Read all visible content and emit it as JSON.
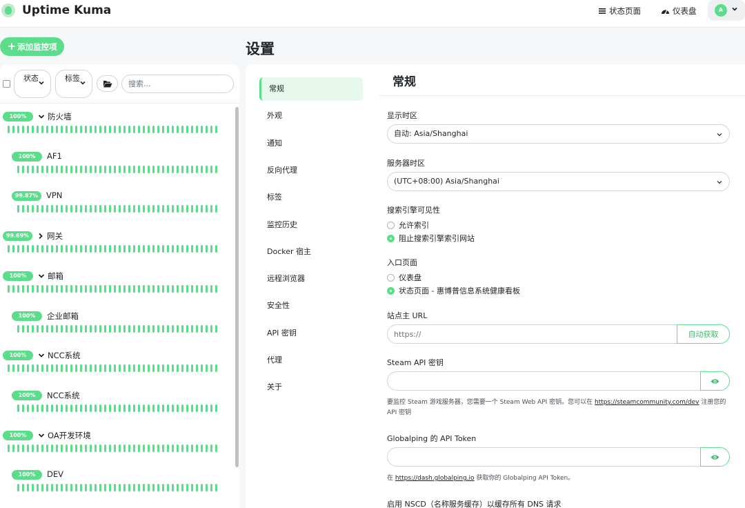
{
  "app": {
    "title": "Uptime Kuma",
    "nav_status": "状态页面",
    "nav_dashboard": "仪表盘",
    "avatar_letter": "A",
    "accent": "#5cdd8b"
  },
  "sidebar": {
    "add_button": "添加监控项",
    "filter_status": "状态",
    "filter_tags": "标签",
    "search_placeholder": "搜索...",
    "monitors": [
      {
        "percent": "100%",
        "name": "防火墙",
        "group": "expanded"
      },
      {
        "percent": "100%",
        "name": "AF1",
        "group": "none"
      },
      {
        "percent": "99.87%",
        "name": "VPN",
        "group": "none"
      },
      {
        "percent": "99.69%",
        "name": "网关",
        "group": "collapsed"
      },
      {
        "percent": "100%",
        "name": "邮箱",
        "group": "expanded"
      },
      {
        "percent": "100%",
        "name": "企业邮箱",
        "group": "none"
      },
      {
        "percent": "100%",
        "name": "NCC系统",
        "group": "expanded"
      },
      {
        "percent": "100%",
        "name": "NCC系统",
        "group": "none"
      },
      {
        "percent": "100%",
        "name": "OA开发环境",
        "group": "expanded"
      },
      {
        "percent": "100%",
        "name": "DEV",
        "group": "none"
      }
    ]
  },
  "page": {
    "title": "设置",
    "nav": [
      "常规",
      "外观",
      "通知",
      "反向代理",
      "标签",
      "监控历史",
      "Docker 宿主",
      "远程浏览器",
      "安全性",
      "API 密钥",
      "代理",
      "关于"
    ],
    "active_nav": "常规"
  },
  "general": {
    "section_title": "常规",
    "display_tz_label": "显示时区",
    "display_tz_value": "自动: Asia/Shanghai",
    "server_tz_label": "服务器时区",
    "server_tz_value": "(UTC+08:00) Asia/Shanghai",
    "search_vis_label": "搜索引擎可见性",
    "search_vis_options": [
      {
        "label": "允许索引",
        "checked": false
      },
      {
        "label": "阻止搜索引擎索引网站",
        "checked": true
      }
    ],
    "entry_label": "入口页面",
    "entry_options": [
      {
        "label": "仪表盘",
        "checked": false
      },
      {
        "label": "状态页面 - 惠博普信息系统健康看板",
        "checked": true
      }
    ],
    "base_url_label": "站点主 URL",
    "base_url_placeholder": "https://",
    "auto_get_button": "自动获取",
    "steam_label": "Steam API 密钥",
    "steam_help_before": "要监控 Steam 游戏服务器，您需要一个 Steam Web API 密钥。您可以在 ",
    "steam_help_link": "https://steamcommunity.com/dev",
    "steam_help_after": " 注册您的 API 密钥",
    "globalping_label": "Globalping 的 API Token",
    "globalping_help_before": "在 ",
    "globalping_help_link": "https://dash.globalping.io",
    "globalping_help_after": " 获取你的 Globalping API Token。",
    "nscd_label": "启用 NSCD（名称服务缓存）以缓存所有 DNS 请求"
  }
}
